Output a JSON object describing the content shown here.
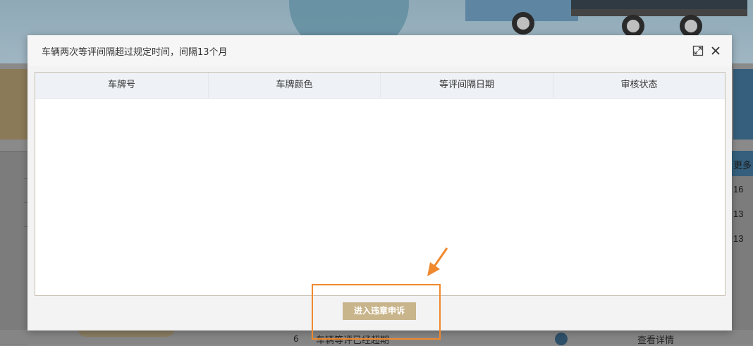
{
  "modal": {
    "title": "车辆两次等评间隔超过规定时间，间隔13个月",
    "maximize_icon": "maximize-icon",
    "close_icon": "close-icon",
    "table": {
      "columns": [
        "车牌号",
        "车牌颜色",
        "等评间隔日期",
        "审核状态"
      ],
      "rows": []
    },
    "footer_button_label": "进入违章申诉"
  },
  "background": {
    "right_header_text": "更多",
    "right_values": [
      "16",
      "13",
      "13"
    ],
    "bottom_row": {
      "index": "6",
      "text": "车辆等评已经超期",
      "link": "查看详情"
    }
  },
  "colors": {
    "overlay": "#8a8a8a",
    "button": "#c9b58b",
    "annotation": "#f0892e",
    "table_border": "#c9c2b3",
    "table_header": "#eef2f6"
  }
}
